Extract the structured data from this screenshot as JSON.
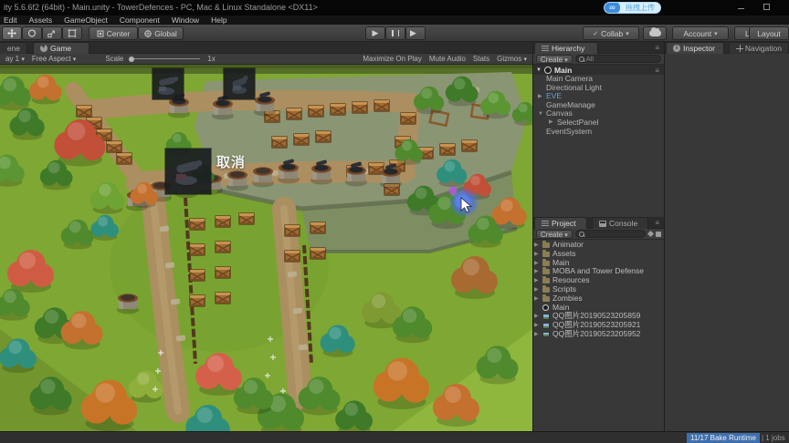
{
  "window": {
    "title": "ity 5.6.6f2 (64bit) - Main.unity - TowerDefences - PC, Mac & Linux Standalone <DX11>",
    "upload_badge": "拖拽上传"
  },
  "menu": {
    "items": [
      "Edit",
      "Assets",
      "GameObject",
      "Component",
      "Window",
      "Help"
    ]
  },
  "toolbar": {
    "center": "Center",
    "global": "Global",
    "collab": "Collab",
    "account": "Account",
    "layers": "Layers",
    "layout": "Layout"
  },
  "game_panel": {
    "scene_tab": "ene",
    "game_tab": "Game",
    "display": "ay 1",
    "aspect": "Free Aspect",
    "scale_label": "Scale",
    "scale_value": "1x",
    "maximize_on_play": "Maximize On Play",
    "mute_audio": "Mute Audio",
    "stats": "Stats",
    "gizmos": "Gizmos",
    "overlay_cancel": "取消"
  },
  "hierarchy": {
    "tab": "Hierarchy",
    "create": "Create",
    "search_text": "All",
    "scene_name": "Main",
    "items": [
      {
        "label": "Main Camera",
        "indent": 1,
        "arrow": "",
        "blue": false
      },
      {
        "label": "Directional Light",
        "indent": 1,
        "arrow": "",
        "blue": false
      },
      {
        "label": "EVE",
        "indent": 1,
        "arrow": "▶",
        "blue": true
      },
      {
        "label": "GameManage",
        "indent": 1,
        "arrow": "",
        "blue": false
      },
      {
        "label": "Canvas",
        "indent": 1,
        "arrow": "▼",
        "blue": false
      },
      {
        "label": "SelectPanel",
        "indent": 2,
        "arrow": "▶",
        "blue": false
      },
      {
        "label": "EventSystem",
        "indent": 1,
        "arrow": "",
        "blue": false
      }
    ]
  },
  "project": {
    "tab": "Project",
    "console_tab": "Console",
    "create": "Create",
    "items": [
      {
        "label": "Animator",
        "icon": "folder",
        "arrow": "▶"
      },
      {
        "label": "Assets",
        "icon": "folder",
        "arrow": "▶"
      },
      {
        "label": "Main",
        "icon": "folder",
        "arrow": "▶"
      },
      {
        "label": "MOBA and Tower Defense",
        "icon": "folder",
        "arrow": "▶"
      },
      {
        "label": "Resources",
        "icon": "folder",
        "arrow": "▶"
      },
      {
        "label": "Scripts",
        "icon": "folder",
        "arrow": "▶"
      },
      {
        "label": "Zombies",
        "icon": "folder",
        "arrow": "▶"
      },
      {
        "label": "Main",
        "icon": "scene",
        "arrow": ""
      },
      {
        "label": "QQ图片20190523205859",
        "icon": "image",
        "arrow": "▶"
      },
      {
        "label": "QQ图片20190523205921",
        "icon": "image",
        "arrow": "▶"
      },
      {
        "label": "QQ图片20190523205952",
        "icon": "image",
        "arrow": "▶"
      }
    ]
  },
  "inspector": {
    "tab": "Inspector",
    "navigation_tab": "Navigation"
  },
  "status": {
    "bake": "11/17 Bake Runtime",
    "jobs": "| 1 jobs"
  },
  "colors": {
    "accent_blue": "#3e6fae",
    "selection_blue": "#6b9fd8",
    "badge_blue": "#3b8de0"
  }
}
